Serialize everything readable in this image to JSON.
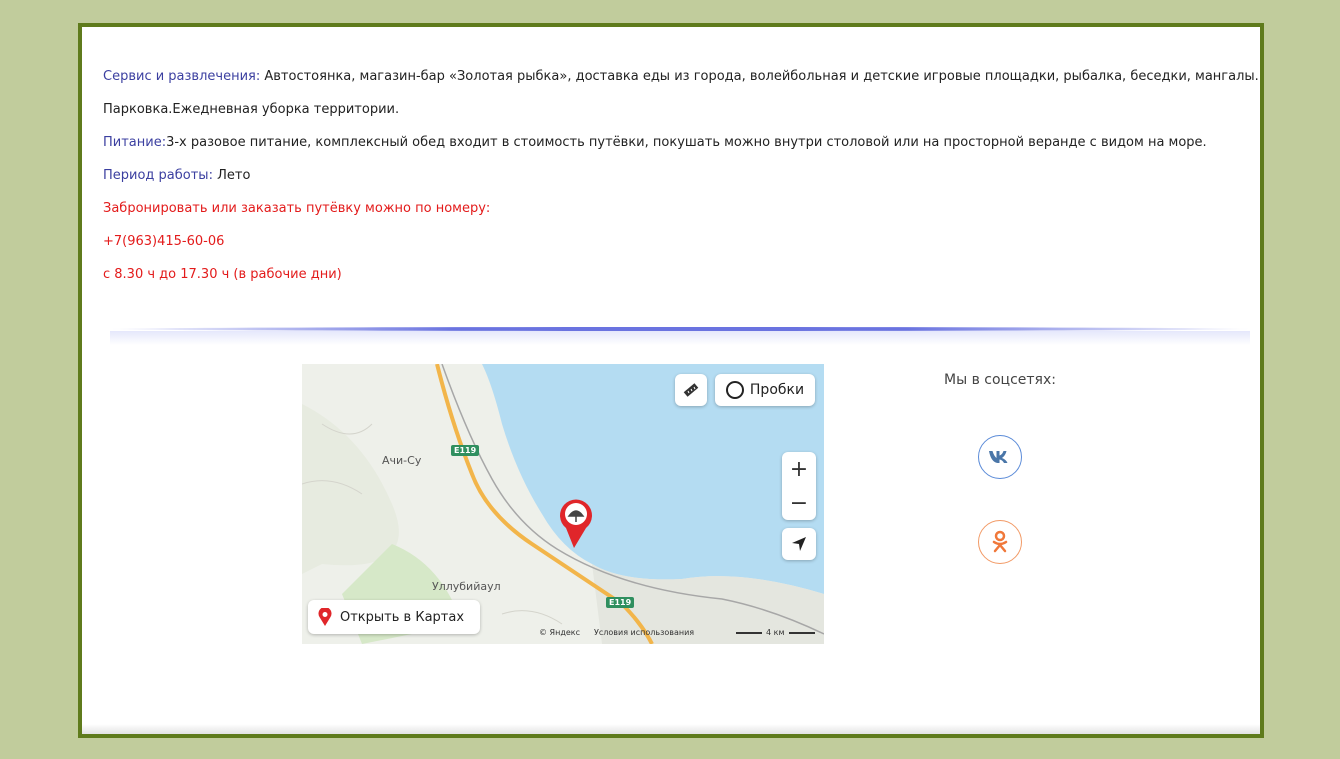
{
  "info": {
    "services_label": "Сервис и развлечения:",
    "services_text": " Автостоянка, магазин-бар «Золотая рыбка», доставка еды из города, волейбольная и детские игровые площадки, рыбалка, беседки, мангалы.",
    "parking_text": "Парковка.Ежедневная уборка территории.",
    "food_label": "Питание:",
    "food_text": "3-х разовое питание, комплексный обед входит в стоимость путёвки, покушать можно внутри столовой или на просторной веранде с видом на море.",
    "period_label": "Период работы:",
    "period_text": " Лето",
    "booking_text": "Забронировать или заказать путёвку можно по номеру:",
    "phone": "+7(963)415-60-06",
    "hours": "с 8.30 ч до 17.30 ч (в рабочие дни)"
  },
  "map": {
    "place_achi_su": "Ачи-Су",
    "place_ullubiyaul": "Уллубийаул",
    "road_badge_1": "E119",
    "road_badge_2": "E119",
    "traffic_label": "Пробки",
    "zoom_in": "+",
    "zoom_out": "−",
    "open_in_maps": "Открыть в Картах",
    "copyright": "© Яндекс",
    "terms": "Условия использования",
    "scale_label": "4 км",
    "colors": {
      "sea": "#b4dcf2",
      "land": "#eef0ea",
      "road": "#f2b54a",
      "pin": "#e0262a"
    }
  },
  "social": {
    "title": "Мы в соцсетях:",
    "vk_icon": "vk-icon",
    "ok_icon": "odnoklassniki-icon",
    "vk_color": "#5b8bd8",
    "ok_color": "#f29a66"
  },
  "colors": {
    "page_bg": "#c1cc9c",
    "frame_border": "#5f7b1c",
    "label_color": "#3b3fa0",
    "highlight_red": "#e31b1b"
  }
}
